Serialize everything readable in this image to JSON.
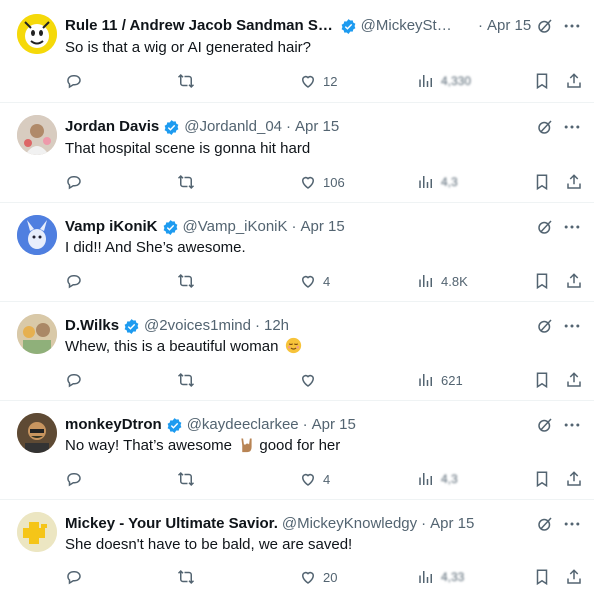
{
  "tweets": [
    {
      "name": "Rule 11 / Andrew Jacob Sandman Say...",
      "handle": "@MickeySte...",
      "time": "Apr 15",
      "text": "So is that a wig or AI generated hair?",
      "likes": "12",
      "views": "4,330",
      "avatar_color": "#f5d90a"
    },
    {
      "name": "Jordan Davis",
      "handle": "@Jordanld_04",
      "time": "Apr 15",
      "text": "That hospital scene is gonna hit hard",
      "likes": "106",
      "views": "4,3",
      "avatar_color": "#c9b8a8"
    },
    {
      "name": "Vamp iKoniK",
      "handle": "@Vamp_iKoniK",
      "time": "Apr 15",
      "text": "I did!! And She’s awesome.",
      "likes": "4",
      "views": "4.8K",
      "avatar_color": "#3d6fd1"
    },
    {
      "name": "D.Wilks",
      "handle": "@2voices1mind",
      "time": "12h",
      "text": "Whew, this is a beautiful woman",
      "likes": "",
      "views": "621",
      "avatar_color": "#c7b49a"
    },
    {
      "name": "monkeyDtron",
      "handle": "@kaydeeclarkee",
      "time": "Apr 15",
      "text_before": "No way! That’s awesome",
      "text_after": "good for her",
      "likes": "4",
      "views": "4,3",
      "avatar_color": "#7a5a3a"
    },
    {
      "name": "Mickey - Your Ultimate Savior.",
      "handle": "@MickeyKnowledgy",
      "time": "Apr 15",
      "text": "She doesn't have to be bald, we are saved!",
      "likes": "20",
      "views": "4,33",
      "avatar_color": "#e8e2b8"
    }
  ],
  "colors": {
    "verified": "#1d9bf0",
    "muted": "#536471",
    "divider": "#eff3f4"
  },
  "icons": [
    "verified-badge-icon",
    "grok-icon",
    "more-icon",
    "reply-icon",
    "retweet-icon",
    "like-icon",
    "views-icon",
    "bookmark-icon",
    "share-icon"
  ]
}
